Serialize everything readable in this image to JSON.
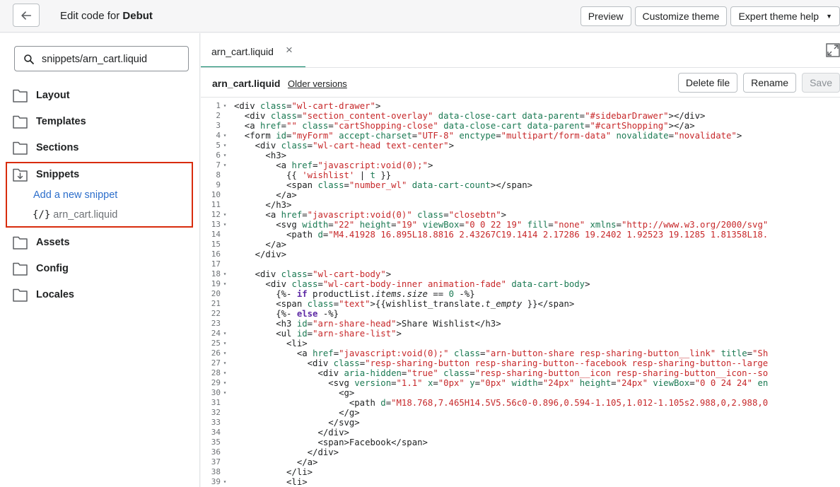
{
  "header": {
    "title_prefix": "Edit code for ",
    "theme_name": "Debut",
    "preview_label": "Preview",
    "customize_label": "Customize theme",
    "help_label": "Expert theme help"
  },
  "sidebar": {
    "search_value": "snippets/arn_cart.liquid",
    "folders": {
      "layout": "Layout",
      "templates": "Templates",
      "sections": "Sections",
      "snippets": "Snippets",
      "assets": "Assets",
      "config": "Config",
      "locales": "Locales"
    },
    "add_snippet": "Add a new snippet",
    "file_icon": "{/}",
    "file_name": "arn_cart.liquid"
  },
  "editor": {
    "tab_name": "arn_cart.liquid",
    "tab_close": "×",
    "file_name": "arn_cart.liquid",
    "older_versions": "Older versions",
    "delete_label": "Delete file",
    "rename_label": "Rename",
    "save_label": "Save"
  },
  "code_lines": [
    {
      "n": 1,
      "fold": true,
      "tokens": [
        [
          "tg",
          "<div "
        ],
        [
          "at",
          "class"
        ],
        [
          "tg",
          "="
        ],
        [
          "st",
          "\"wl-cart-drawer\""
        ],
        [
          "tg",
          ">"
        ]
      ]
    },
    {
      "n": 2,
      "fold": false,
      "tokens": [
        [
          "tg",
          "  <div "
        ],
        [
          "at",
          "class"
        ],
        [
          "tg",
          "="
        ],
        [
          "st",
          "\"section_content-overlay\""
        ],
        [
          "tg",
          " "
        ],
        [
          "at",
          "data-close-cart"
        ],
        [
          "tg",
          " "
        ],
        [
          "at",
          "data-parent"
        ],
        [
          "tg",
          "="
        ],
        [
          "st",
          "\"#sidebarDrawer\""
        ],
        [
          "tg",
          "></div>"
        ]
      ]
    },
    {
      "n": 3,
      "fold": false,
      "tokens": [
        [
          "tg",
          "  <a "
        ],
        [
          "at",
          "href"
        ],
        [
          "tg",
          "="
        ],
        [
          "st",
          "\"\""
        ],
        [
          "tg",
          " "
        ],
        [
          "at",
          "class"
        ],
        [
          "tg",
          "="
        ],
        [
          "st",
          "\"cartShopping-close\""
        ],
        [
          "tg",
          " "
        ],
        [
          "at",
          "data-close-cart"
        ],
        [
          "tg",
          " "
        ],
        [
          "at",
          "data-parent"
        ],
        [
          "tg",
          "="
        ],
        [
          "st",
          "\"#cartShopping\""
        ],
        [
          "tg",
          "></a>"
        ]
      ]
    },
    {
      "n": 4,
      "fold": true,
      "tokens": [
        [
          "tg",
          "  <form "
        ],
        [
          "at",
          "id"
        ],
        [
          "tg",
          "="
        ],
        [
          "st",
          "\"myForm\""
        ],
        [
          "tg",
          " "
        ],
        [
          "at",
          "accept-charset"
        ],
        [
          "tg",
          "="
        ],
        [
          "st",
          "\"UTF-8\""
        ],
        [
          "tg",
          " "
        ],
        [
          "at",
          "enctype"
        ],
        [
          "tg",
          "="
        ],
        [
          "st",
          "\"multipart/form-data\""
        ],
        [
          "tg",
          " "
        ],
        [
          "at",
          "novalidate"
        ],
        [
          "tg",
          "="
        ],
        [
          "st",
          "\"novalidate\""
        ],
        [
          "tg",
          ">"
        ]
      ]
    },
    {
      "n": 5,
      "fold": true,
      "tokens": [
        [
          "tg",
          "    <div "
        ],
        [
          "at",
          "class"
        ],
        [
          "tg",
          "="
        ],
        [
          "st",
          "\"wl-cart-head text-center\""
        ],
        [
          "tg",
          ">"
        ]
      ]
    },
    {
      "n": 6,
      "fold": true,
      "tokens": [
        [
          "tg",
          "      <h3>"
        ]
      ]
    },
    {
      "n": 7,
      "fold": true,
      "tokens": [
        [
          "tg",
          "        <a "
        ],
        [
          "at",
          "href"
        ],
        [
          "tg",
          "="
        ],
        [
          "st",
          "\"javascript:void(0);\""
        ],
        [
          "tg",
          ">"
        ]
      ]
    },
    {
      "n": 8,
      "fold": false,
      "tokens": [
        [
          "lq",
          "          {{ "
        ],
        [
          "st",
          "'wishlist'"
        ],
        [
          "lq",
          " | "
        ],
        [
          "at",
          "t"
        ],
        [
          "lq",
          " }}"
        ]
      ]
    },
    {
      "n": 9,
      "fold": false,
      "tokens": [
        [
          "tg",
          "          <span "
        ],
        [
          "at",
          "class"
        ],
        [
          "tg",
          "="
        ],
        [
          "st",
          "\"number_wl\""
        ],
        [
          "tg",
          " "
        ],
        [
          "at",
          "data-cart-count"
        ],
        [
          "tg",
          "></span>"
        ]
      ]
    },
    {
      "n": 10,
      "fold": false,
      "tokens": [
        [
          "tg",
          "        </a>"
        ]
      ]
    },
    {
      "n": 11,
      "fold": false,
      "tokens": [
        [
          "tg",
          "      </h3>"
        ]
      ]
    },
    {
      "n": 12,
      "fold": true,
      "tokens": [
        [
          "tg",
          "      <a "
        ],
        [
          "at",
          "href"
        ],
        [
          "tg",
          "="
        ],
        [
          "st",
          "\"javascript:void(0)\""
        ],
        [
          "tg",
          " "
        ],
        [
          "at",
          "class"
        ],
        [
          "tg",
          "="
        ],
        [
          "st",
          "\"closebtn\""
        ],
        [
          "tg",
          ">"
        ]
      ]
    },
    {
      "n": 13,
      "fold": true,
      "tokens": [
        [
          "tg",
          "        <svg "
        ],
        [
          "at",
          "width"
        ],
        [
          "tg",
          "="
        ],
        [
          "st",
          "\"22\""
        ],
        [
          "tg",
          " "
        ],
        [
          "at",
          "height"
        ],
        [
          "tg",
          "="
        ],
        [
          "st",
          "\"19\""
        ],
        [
          "tg",
          " "
        ],
        [
          "at",
          "viewBox"
        ],
        [
          "tg",
          "="
        ],
        [
          "st",
          "\"0 0 22 19\""
        ],
        [
          "tg",
          " "
        ],
        [
          "at",
          "fill"
        ],
        [
          "tg",
          "="
        ],
        [
          "st",
          "\"none\""
        ],
        [
          "tg",
          " "
        ],
        [
          "at",
          "xmlns"
        ],
        [
          "tg",
          "="
        ],
        [
          "st",
          "\"http://www.w3.org/2000/svg\""
        ]
      ]
    },
    {
      "n": 14,
      "fold": false,
      "tokens": [
        [
          "tg",
          "          <path "
        ],
        [
          "at",
          "d"
        ],
        [
          "tg",
          "="
        ],
        [
          "st",
          "\"M4.41928 16.895L18.8816 2.43267C19.1414 2.17286 19.2402 1.92523 19.1285 1.81358L18."
        ]
      ]
    },
    {
      "n": 15,
      "fold": false,
      "tokens": [
        [
          "tg",
          "      </a>"
        ]
      ]
    },
    {
      "n": 16,
      "fold": false,
      "tokens": [
        [
          "tg",
          "    </div>"
        ]
      ]
    },
    {
      "n": 17,
      "fold": false,
      "tokens": []
    },
    {
      "n": 18,
      "fold": true,
      "tokens": [
        [
          "tg",
          "    <div "
        ],
        [
          "at",
          "class"
        ],
        [
          "tg",
          "="
        ],
        [
          "st",
          "\"wl-cart-body\""
        ],
        [
          "tg",
          ">"
        ]
      ]
    },
    {
      "n": 19,
      "fold": true,
      "tokens": [
        [
          "tg",
          "      <div "
        ],
        [
          "at",
          "class"
        ],
        [
          "tg",
          "="
        ],
        [
          "st",
          "\"wl-cart-body-inner animation-fade\""
        ],
        [
          "tg",
          " "
        ],
        [
          "at",
          "data-cart-body"
        ],
        [
          "tg",
          ">"
        ]
      ]
    },
    {
      "n": 20,
      "fold": false,
      "tokens": [
        [
          "lq",
          "        {%- "
        ],
        [
          "kw",
          "if"
        ],
        [
          "lq",
          " productList."
        ],
        [
          "em",
          "items.size"
        ],
        [
          "lq",
          " == "
        ],
        [
          "at",
          "0"
        ],
        [
          "lq",
          " -%}"
        ]
      ]
    },
    {
      "n": 21,
      "fold": false,
      "tokens": [
        [
          "tg",
          "        <span "
        ],
        [
          "at",
          "class"
        ],
        [
          "tg",
          "="
        ],
        [
          "st",
          "\"text\""
        ],
        [
          "tg",
          ">{{"
        ],
        [
          "lq",
          "wishlist_translate."
        ],
        [
          "em",
          "t_empty"
        ],
        [
          "lq",
          " }}"
        ],
        [
          "tg",
          "</span>"
        ]
      ]
    },
    {
      "n": 22,
      "fold": false,
      "tokens": [
        [
          "lq",
          "        {%- "
        ],
        [
          "kw",
          "else"
        ],
        [
          "lq",
          " -%}"
        ]
      ]
    },
    {
      "n": 23,
      "fold": false,
      "tokens": [
        [
          "tg",
          "        <h3 "
        ],
        [
          "at",
          "id"
        ],
        [
          "tg",
          "="
        ],
        [
          "st",
          "\"arn-share-head\""
        ],
        [
          "tg",
          ">Share Wishlist</h3>"
        ]
      ]
    },
    {
      "n": 24,
      "fold": true,
      "tokens": [
        [
          "tg",
          "        <ul "
        ],
        [
          "at",
          "id"
        ],
        [
          "tg",
          "="
        ],
        [
          "st",
          "\"arn-share-list\""
        ],
        [
          "tg",
          ">"
        ]
      ]
    },
    {
      "n": 25,
      "fold": true,
      "tokens": [
        [
          "tg",
          "          <li>"
        ]
      ]
    },
    {
      "n": 26,
      "fold": true,
      "tokens": [
        [
          "tg",
          "            <a "
        ],
        [
          "at",
          "href"
        ],
        [
          "tg",
          "="
        ],
        [
          "st",
          "\"javascript:void(0);\""
        ],
        [
          "tg",
          " "
        ],
        [
          "at",
          "class"
        ],
        [
          "tg",
          "="
        ],
        [
          "st",
          "\"arn-button-share resp-sharing-button__link\""
        ],
        [
          "tg",
          " "
        ],
        [
          "at",
          "title"
        ],
        [
          "tg",
          "="
        ],
        [
          "st",
          "\"Sh"
        ]
      ]
    },
    {
      "n": 27,
      "fold": true,
      "tokens": [
        [
          "tg",
          "              <div "
        ],
        [
          "at",
          "class"
        ],
        [
          "tg",
          "="
        ],
        [
          "st",
          "\"resp-sharing-button resp-sharing-button--facebook resp-sharing-button--large"
        ]
      ]
    },
    {
      "n": 28,
      "fold": true,
      "tokens": [
        [
          "tg",
          "                <div "
        ],
        [
          "at",
          "aria-hidden"
        ],
        [
          "tg",
          "="
        ],
        [
          "st",
          "\"true\""
        ],
        [
          "tg",
          " "
        ],
        [
          "at",
          "class"
        ],
        [
          "tg",
          "="
        ],
        [
          "st",
          "\"resp-sharing-button__icon resp-sharing-button__icon--so"
        ]
      ]
    },
    {
      "n": 29,
      "fold": true,
      "tokens": [
        [
          "tg",
          "                  <svg "
        ],
        [
          "at",
          "version"
        ],
        [
          "tg",
          "="
        ],
        [
          "st",
          "\"1.1\""
        ],
        [
          "tg",
          " "
        ],
        [
          "at",
          "x"
        ],
        [
          "tg",
          "="
        ],
        [
          "st",
          "\"0px\""
        ],
        [
          "tg",
          " "
        ],
        [
          "at",
          "y"
        ],
        [
          "tg",
          "="
        ],
        [
          "st",
          "\"0px\""
        ],
        [
          "tg",
          " "
        ],
        [
          "at",
          "width"
        ],
        [
          "tg",
          "="
        ],
        [
          "st",
          "\"24px\""
        ],
        [
          "tg",
          " "
        ],
        [
          "at",
          "height"
        ],
        [
          "tg",
          "="
        ],
        [
          "st",
          "\"24px\""
        ],
        [
          "tg",
          " "
        ],
        [
          "at",
          "viewBox"
        ],
        [
          "tg",
          "="
        ],
        [
          "st",
          "\"0 0 24 24\""
        ],
        [
          "tg",
          " "
        ],
        [
          "at",
          "en"
        ]
      ]
    },
    {
      "n": 30,
      "fold": true,
      "tokens": [
        [
          "tg",
          "                    <g>"
        ]
      ]
    },
    {
      "n": 31,
      "fold": false,
      "tokens": [
        [
          "tg",
          "                      <path "
        ],
        [
          "at",
          "d"
        ],
        [
          "tg",
          "="
        ],
        [
          "st",
          "\"M18.768,7.465H14.5V5.56c0-0.896,0.594-1.105,1.012-1.105s2.988,0,2.988,0"
        ]
      ]
    },
    {
      "n": 32,
      "fold": false,
      "tokens": [
        [
          "tg",
          "                    </g>"
        ]
      ]
    },
    {
      "n": 33,
      "fold": false,
      "tokens": [
        [
          "tg",
          "                  </svg>"
        ]
      ]
    },
    {
      "n": 34,
      "fold": false,
      "tokens": [
        [
          "tg",
          "                </div>"
        ]
      ]
    },
    {
      "n": 35,
      "fold": false,
      "tokens": [
        [
          "tg",
          "                <span>Facebook</span>"
        ]
      ]
    },
    {
      "n": 36,
      "fold": false,
      "tokens": [
        [
          "tg",
          "              </div>"
        ]
      ]
    },
    {
      "n": 37,
      "fold": false,
      "tokens": [
        [
          "tg",
          "            </a>"
        ]
      ]
    },
    {
      "n": 38,
      "fold": false,
      "tokens": [
        [
          "tg",
          "          </li>"
        ]
      ]
    },
    {
      "n": 39,
      "fold": true,
      "tokens": [
        [
          "tg",
          "          <li>"
        ]
      ]
    }
  ]
}
